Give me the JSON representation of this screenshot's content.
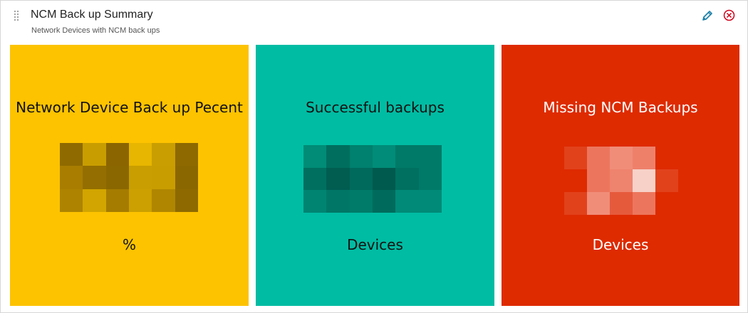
{
  "widget": {
    "title": "NCM Back up Summary",
    "subtitle": "Network Devices with NCM back ups",
    "icons": [
      "drag-handle-icon",
      "pencil-icon",
      "close-icon"
    ]
  },
  "tiles": [
    {
      "title": "Network Device Back up Pecent",
      "unit": "%",
      "color": "#fdc300"
    },
    {
      "title": "Successful backups",
      "unit": "Devices",
      "color": "#00bca3"
    },
    {
      "title": "Missing NCM Backups",
      "unit": "Devices",
      "color": "#de2b00"
    }
  ]
}
